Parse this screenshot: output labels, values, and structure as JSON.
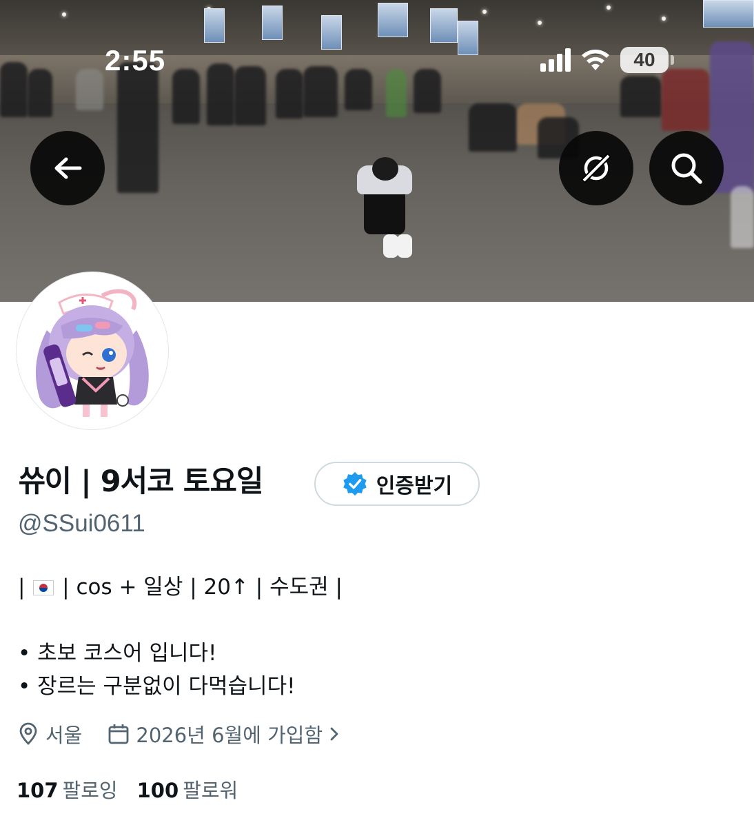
{
  "status_bar": {
    "time": "2:55",
    "battery": "40"
  },
  "header": {
    "back_icon": "arrow-left-icon",
    "grok_icon": "grok-icon",
    "search_icon": "search-icon"
  },
  "profile": {
    "display_name": "쓔이 | 9서코 토요일",
    "verify_label": "인증받기",
    "handle": "@SSui0611",
    "bio": {
      "line1_pre": "| ",
      "line1_post": " | cos + 일상 | 20↑ | 수도권 |",
      "line2": "• 초보 코스어 입니다!",
      "line3": "• 장르는 구분없이 다먹습니다!"
    },
    "location": "서울",
    "joined": "2026년 6월에 가입함",
    "following_count": "107",
    "following_label": "팔로잉",
    "followers_count": "100",
    "followers_label": "팔로워"
  },
  "colors": {
    "text_primary": "#0f1419",
    "text_secondary": "#536471",
    "verified_blue": "#1d9bf0",
    "border": "#cfd9de"
  }
}
